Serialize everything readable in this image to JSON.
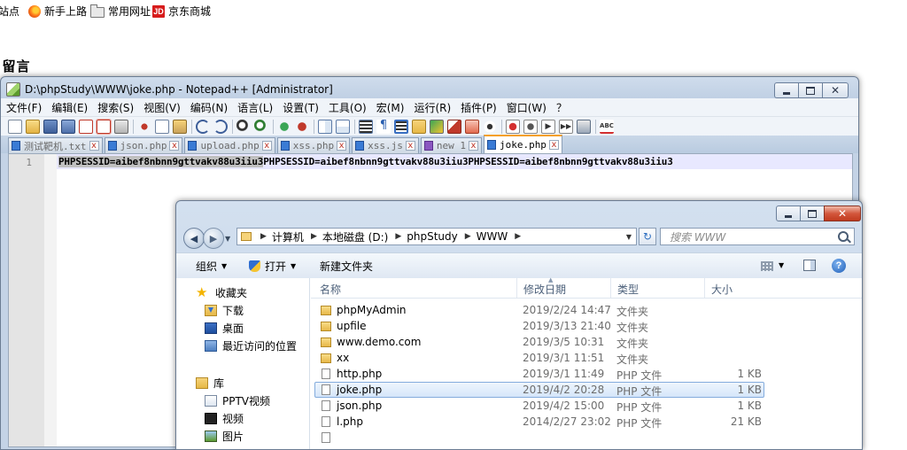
{
  "browser": {
    "bookmarks": [
      {
        "label": "站点",
        "icon": "none"
      },
      {
        "label": "新手上路",
        "icon": "firefox-icon"
      },
      {
        "label": "常用网址",
        "icon": "folder-icon"
      },
      {
        "label": "京东商城",
        "icon": "jd-icon",
        "badge": "JD"
      }
    ],
    "page_heading": "|留言"
  },
  "notepad": {
    "title": "D:\\phpStudy\\WWW\\joke.php - Notepad++ [Administrator]",
    "menu": [
      "文件(F)",
      "编辑(E)",
      "搜索(S)",
      "视图(V)",
      "编码(N)",
      "语言(L)",
      "设置(T)",
      "工具(O)",
      "宏(M)",
      "运行(R)",
      "插件(P)",
      "窗口(W)",
      "？"
    ],
    "tabs": [
      {
        "label": "测试靶机.txt",
        "active": false
      },
      {
        "label": "json.php",
        "active": false
      },
      {
        "label": "upload.php",
        "active": false
      },
      {
        "label": "xss.php",
        "active": false
      },
      {
        "label": "xss.js",
        "active": false
      },
      {
        "label": "new 1",
        "active": false
      },
      {
        "label": "joke.php",
        "active": true
      }
    ],
    "tab_close_glyph": "x",
    "line_number": "1",
    "code_selected": "PHPSESSID=aibef8nbnn9gttvakv88u3iiu3",
    "code_rest": "PHPSESSID=aibef8nbnn9gttvakv88u3iiu3PHPSESSID=aibef8nbnn9gttvakv88u3iiu3",
    "colors": {
      "selection": "#c0c0c0",
      "current_line": "#e8e8ff",
      "active_tab_accent": "#f5a02a"
    }
  },
  "explorer": {
    "breadcrumb": [
      "计算机",
      "本地磁盘 (D:)",
      "phpStudy",
      "WWW"
    ],
    "search_placeholder": "搜索 WWW",
    "commands": {
      "organize": "组织",
      "open": "打开",
      "new_folder": "新建文件夹"
    },
    "help_glyph": "?",
    "nav": {
      "favorites": "收藏夹",
      "downloads": "下载",
      "desktop": "桌面",
      "recent": "最近访问的位置",
      "libraries": "库",
      "pptv": "PPTV视频",
      "videos": "视频",
      "pictures": "图片"
    },
    "columns": {
      "name": "名称",
      "date": "修改日期",
      "type": "类型",
      "size": "大小"
    },
    "files": [
      {
        "name": "phpMyAdmin",
        "date": "2019/2/24 14:47",
        "type": "文件夹",
        "size": "",
        "kind": "folder"
      },
      {
        "name": "upfile",
        "date": "2019/3/13 21:40",
        "type": "文件夹",
        "size": "",
        "kind": "folder"
      },
      {
        "name": "www.demo.com",
        "date": "2019/3/5 10:31",
        "type": "文件夹",
        "size": "",
        "kind": "folder"
      },
      {
        "name": "xx",
        "date": "2019/3/1 11:51",
        "type": "文件夹",
        "size": "",
        "kind": "folder"
      },
      {
        "name": "http.php",
        "date": "2019/3/1 11:49",
        "type": "PHP 文件",
        "size": "1 KB",
        "kind": "file"
      },
      {
        "name": "joke.php",
        "date": "2019/4/2 20:28",
        "type": "PHP 文件",
        "size": "1 KB",
        "kind": "file",
        "selected": true
      },
      {
        "name": "json.php",
        "date": "2019/4/2 15:00",
        "type": "PHP 文件",
        "size": "1 KB",
        "kind": "file"
      },
      {
        "name": "l.php",
        "date": "2014/2/27 23:02",
        "type": "PHP 文件",
        "size": "21 KB",
        "kind": "file"
      },
      {
        "name": "",
        "date": "",
        "type": "",
        "size": "",
        "kind": "file"
      }
    ]
  }
}
